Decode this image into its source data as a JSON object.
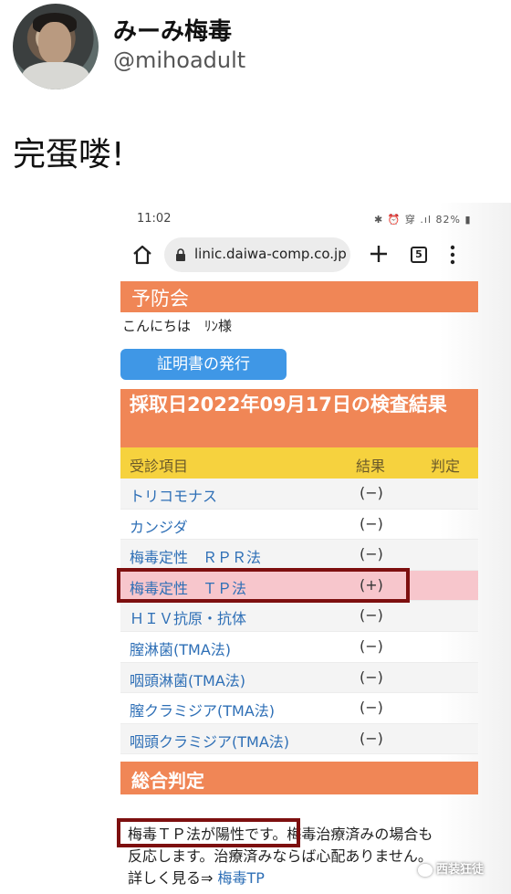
{
  "tweet": {
    "display_name": "みーみ梅毒",
    "handle": "@mihoadult",
    "text": "完蛋喽!"
  },
  "phone": {
    "status_time": "11:02",
    "status_icons": "✱ ⏰ 穿 .ıl 82% ▮",
    "url": "linic.daiwa-comp.co.jp",
    "tab_count": "5"
  },
  "page": {
    "header": "予防会",
    "greeting": "こんにちは　ﾘﾝ様",
    "certificate_button": "証明書の発行",
    "result_title": "採取日2022年09月17日の検査結果",
    "columns": [
      "受診項目",
      "結果",
      "判定"
    ],
    "rows": [
      {
        "item": "トリコモナス",
        "result": "(−)"
      },
      {
        "item": "カンジダ",
        "result": "(−)"
      },
      {
        "item": "梅毒定性　ＲＰＲ法",
        "result": "(−)"
      },
      {
        "item": "梅毒定性　ＴＰ法",
        "result": "(+)"
      },
      {
        "item": "ＨＩＶ抗原・抗体",
        "result": "(−)"
      },
      {
        "item": "膣淋菌(TMA法)",
        "result": "(−)"
      },
      {
        "item": "咽頭淋菌(TMA法)",
        "result": "(−)"
      },
      {
        "item": "膣クラミジア(TMA法)",
        "result": "(−)"
      },
      {
        "item": "咽頭クラミジア(TMA法)",
        "result": "(−)"
      }
    ],
    "summary_header": "総合判定",
    "summary_line1": "梅毒ＴＰ法が陽性です。梅毒治療済みの場合も",
    "summary_line2": "反応します。治療済みならば心配ありません。",
    "summary_more": "詳しく見る⇒",
    "summary_link": "梅毒TP"
  },
  "watermark": "西装狂徒",
  "colors": {
    "orange": "#f08656",
    "yellow": "#f6d23e",
    "button_blue": "#3f97e6",
    "link_blue": "#2e6fb6",
    "highlight_pink": "#f7c6cc",
    "box_red": "#7d0f0f"
  }
}
